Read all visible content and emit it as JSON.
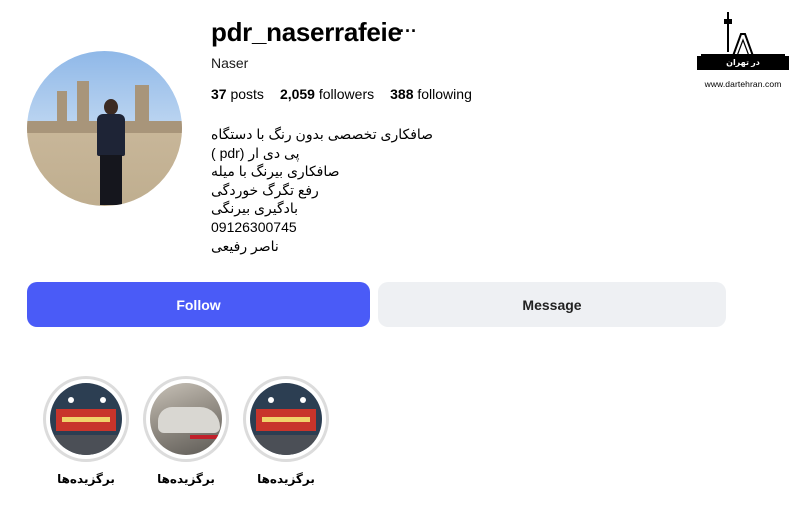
{
  "profile": {
    "username": "pdr_naserrafeie",
    "more_glyph": "···",
    "full_name": "Naser",
    "stats": {
      "posts_count": "37",
      "posts_label": "posts",
      "followers_count": "2,059",
      "followers_label": "followers",
      "following_count": "388",
      "following_label": "following"
    },
    "bio": [
      "صافکاری تخصصی بدون رنگ با دستگاه",
      "پی دی ار (pdr )",
      "صافکاری بیرنگ با میله",
      "رفع تگرگ خوردگی",
      "بادگیری بیرنگی",
      "09126300745",
      "ناصر رفیعی"
    ]
  },
  "actions": {
    "follow_label": "Follow",
    "message_label": "Message"
  },
  "highlights": [
    {
      "label": "برگزیده‌ها",
      "thumb": "shop"
    },
    {
      "label": "برگزیده‌ها",
      "thumb": "car"
    },
    {
      "label": "برگزیده‌ها",
      "thumb": "shop"
    }
  ],
  "watermark": {
    "logo_text": "در تهران",
    "url": "www.dartehran.com"
  },
  "colors": {
    "follow_bg": "#4a5bf7",
    "message_bg": "#eef0f3",
    "highlight_ring": "#dcdcdc"
  }
}
